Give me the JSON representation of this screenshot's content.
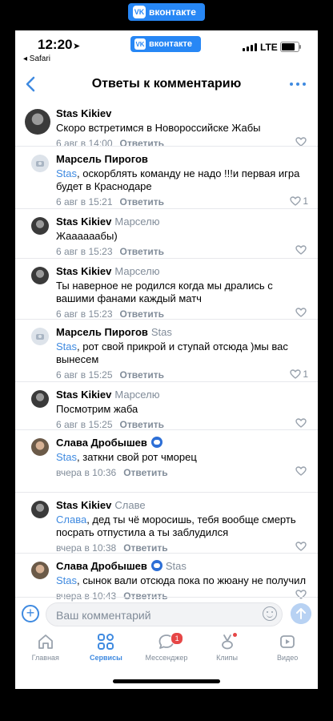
{
  "watermark": "вконтакте",
  "status_bar": {
    "time": "12:20",
    "back_app": "◂ Safari",
    "network": "LTE",
    "app_badge": "вконтакте"
  },
  "header": {
    "title": "Ответы к комментарию"
  },
  "comments": [
    {
      "author": "Stas Kikiev",
      "reply_to": "",
      "avatar": "photo",
      "mention": "",
      "text": "Скоро встретимся в Новороссийске Жабы",
      "date": "6 авг в 14:00",
      "reply_label": "Ответить",
      "likes": ""
    },
    {
      "author": "Марсель Пирогов",
      "reply_to": "",
      "avatar": "camera",
      "mention": "Stas",
      "text": ", оскорблять команду не надо !!!и первая игра будет в Краснодаре",
      "date": "6 авг в 15:21",
      "reply_label": "Ответить",
      "likes": "1"
    },
    {
      "author": "Stas Kikiev",
      "reply_to": "Марселю",
      "avatar": "photo",
      "mention": "",
      "text": "Жаааааабы)",
      "date": "6 авг в 15:23",
      "reply_label": "Ответить",
      "likes": ""
    },
    {
      "author": "Stas Kikiev",
      "reply_to": "Марселю",
      "avatar": "photo",
      "mention": "",
      "text": "Ты наверное не родился когда мы дрались с вашими фанами каждый матч",
      "date": "6 авг в 15:23",
      "reply_label": "Ответить",
      "likes": ""
    },
    {
      "author": "Марсель Пирогов",
      "reply_to": "Stas",
      "avatar": "camera",
      "mention": "Stas",
      "text": ", рот свой прикрой и ступай отсюда )мы вас вынесем",
      "date": "6 авг в 15:25",
      "reply_label": "Ответить",
      "likes": "1"
    },
    {
      "author": "Stas Kikiev",
      "reply_to": "Марселю",
      "avatar": "photo",
      "mention": "",
      "text": "Посмотрим жаба",
      "date": "6 авг в 15:25",
      "reply_label": "Ответить",
      "likes": ""
    },
    {
      "author": "Слава Дробышев",
      "reply_to": "",
      "avatar": "slava",
      "mention": "Stas",
      "text": ", заткни свой рот чморец",
      "date": "вчера в 10:36",
      "reply_label": "Ответить",
      "likes": ""
    },
    {
      "author": "Stas Kikiev",
      "reply_to": "Славе",
      "avatar": "photo",
      "mention": "Слава",
      "text": ", дед ты чё моросишь, тебя вообще смерть посрать отпустила а ты заблудился",
      "date": "вчера в 10:38",
      "reply_label": "Ответить",
      "likes": ""
    },
    {
      "author": "Слава Дробышев",
      "reply_to": "Stas",
      "avatar": "slava",
      "mention": "Stas",
      "text": ", сынок вали отсюда пока по жюану не получил",
      "date": "вчера в 10:43",
      "reply_label": "Ответить",
      "likes": ""
    }
  ],
  "composer": {
    "placeholder": "Ваш комментарий"
  },
  "tabs": [
    {
      "label": "Главная",
      "icon": "home-icon"
    },
    {
      "label": "Сервисы",
      "icon": "services-icon",
      "active": true
    },
    {
      "label": "Мессенджер",
      "icon": "messenger-icon",
      "badge": "1"
    },
    {
      "label": "Клипы",
      "icon": "clips-icon"
    },
    {
      "label": "Видео",
      "icon": "video-icon"
    }
  ],
  "colors": {
    "accent": "#3f8ae0",
    "secondary_text": "#818c99",
    "badge": "#e64646",
    "brand": "#2787f5"
  }
}
